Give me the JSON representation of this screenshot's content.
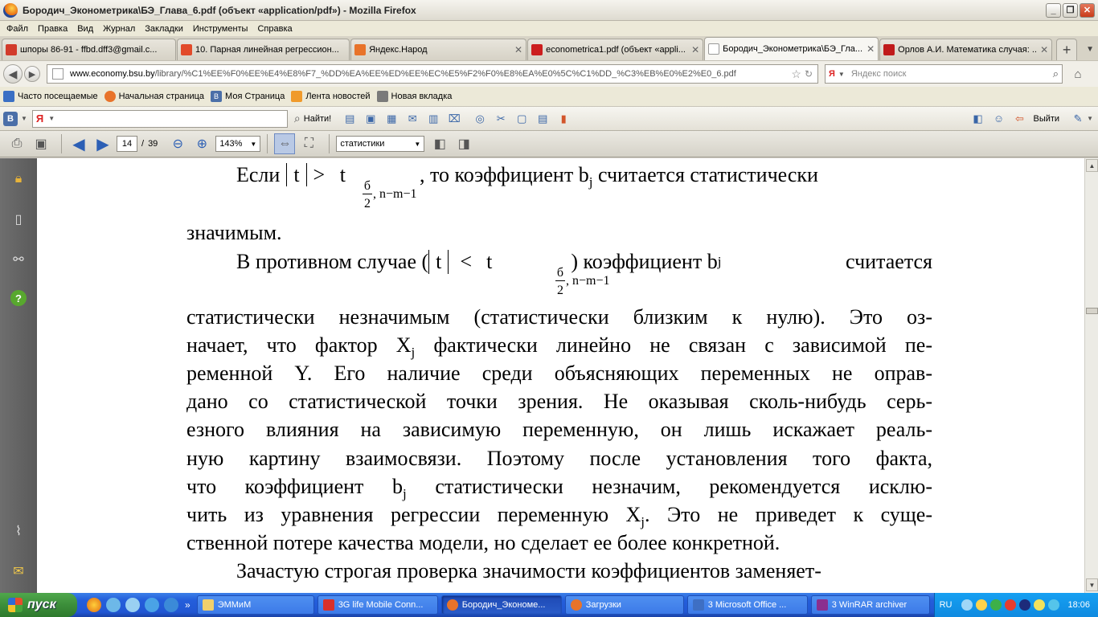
{
  "window": {
    "title": "Бородич_Эконометрика\\БЭ_Глава_6.pdf (объект «application/pdf») - Mozilla Firefox"
  },
  "menu": [
    "Файл",
    "Правка",
    "Вид",
    "Журнал",
    "Закладки",
    "Инструменты",
    "Справка"
  ],
  "tabs": [
    {
      "label": "шпоры 86-91 - ffbd.dff3@gmail.c...",
      "color": "#d23b2b"
    },
    {
      "label": "10. Парная линейная регрессион...",
      "color": "#e24a2a"
    },
    {
      "label": "Яндекс.Народ",
      "color": "#e8732a"
    },
    {
      "label": "econometrica1.pdf (объект «appli...",
      "color": "#cc1e1e"
    },
    {
      "label": "Бородич_Эконометрика\\БЭ_Гла...",
      "color": "#ffffff"
    },
    {
      "label": "Орлов А.И. Математика случая: ...",
      "color": "#c01a1a"
    }
  ],
  "nav": {
    "url_host": "www.economy.bsu.by",
    "url_path": "/library/%C1%EE%F0%EE%E4%E8%F7_%DD%EA%EE%ED%EE%EC%E5%F2%F0%E8%EA%E0%5C%C1%DD_%C3%EB%E0%E2%E0_6.pdf",
    "search_placeholder": "Яндекс поиск",
    "search_engine": "Я"
  },
  "bookmarks": [
    {
      "label": "Часто посещаемые",
      "color": "#3a6fc4"
    },
    {
      "label": "Начальная страница",
      "color": "#e8732a"
    },
    {
      "label": "Моя Страница",
      "color": "#4b6fa8"
    },
    {
      "label": "Лента новостей",
      "color": "#f09a2b"
    },
    {
      "label": "Новая вкладка",
      "color": "#7a7a7a"
    }
  ],
  "yabar": {
    "vk": "В",
    "ya": "Я",
    "find": "Найти!",
    "logout": "Выйти"
  },
  "pdf": {
    "page": "14",
    "page_sep": "/",
    "page_total": "39",
    "zoom": "143%",
    "find": "статистики"
  },
  "doc": {
    "l1_a": "Если",
    "l1_t": "t",
    "l1_gt": ">",
    "l1_t2": "t",
    "l1_b": ", то коэффициент b",
    "l1_j": "j",
    "l1_c": " считается статистически",
    "sub_num": "б",
    "sub_den": "2",
    "sub_rest": ", n−m−1",
    "l2": "значимым.",
    "l3_a": "В противном случае (",
    "l3_t": "t",
    "l3_lt": "<",
    "l3_t2": "t",
    "l3_b": ") коэффициент b",
    "l3_j": "j",
    "l3_c": " считается",
    "l4": "статистически незначимым (статистически близким к нулю). Это оз-",
    "l5_a": "начает, что фактор X",
    "l5_j": "j",
    "l5_b": " фактически линейно не связан с зависимой пе-",
    "l6": "ременной Y. Его наличие среди объясняющих переменных не оправ-",
    "l7": "дано со статистической точки зрения. Не оказывая сколь-нибудь серь-",
    "l8": "езного влияния на зависимую переменную, он лишь искажает реаль-",
    "l9": "ную картину взаимосвязи. Поэтому после установления того факта,",
    "l10_a": "что коэффициент b",
    "l10_j": "j",
    "l10_b": " статистически незначим, рекомендуется исклю-",
    "l11_a": "чить из уравнения регрессии переменную X",
    "l11_j": "j",
    "l11_b": ". Это не приведет к суще-",
    "l12": "ственной потере качества модели, но сделает ее более конкретной.",
    "l13": "Зачастую строгая проверка значимости коэффициентов заменяет-"
  },
  "taskbar": {
    "start": "пуск",
    "tasks": [
      {
        "label": "ЭММиМ",
        "color": "#f2d06b"
      },
      {
        "label": "3G life Mobile Conn...",
        "color": "#d9302a"
      },
      {
        "label": "Бородич_Экономе...",
        "color": "#e8732a"
      },
      {
        "label": "Загрузки",
        "color": "#e8732a"
      },
      {
        "label": "3 Microsoft Office ...",
        "color": "#3e6fc4"
      },
      {
        "label": "3 WinRAR archiver",
        "color": "#8a2f8f"
      }
    ],
    "lang": "RU",
    "time": "18:06"
  }
}
